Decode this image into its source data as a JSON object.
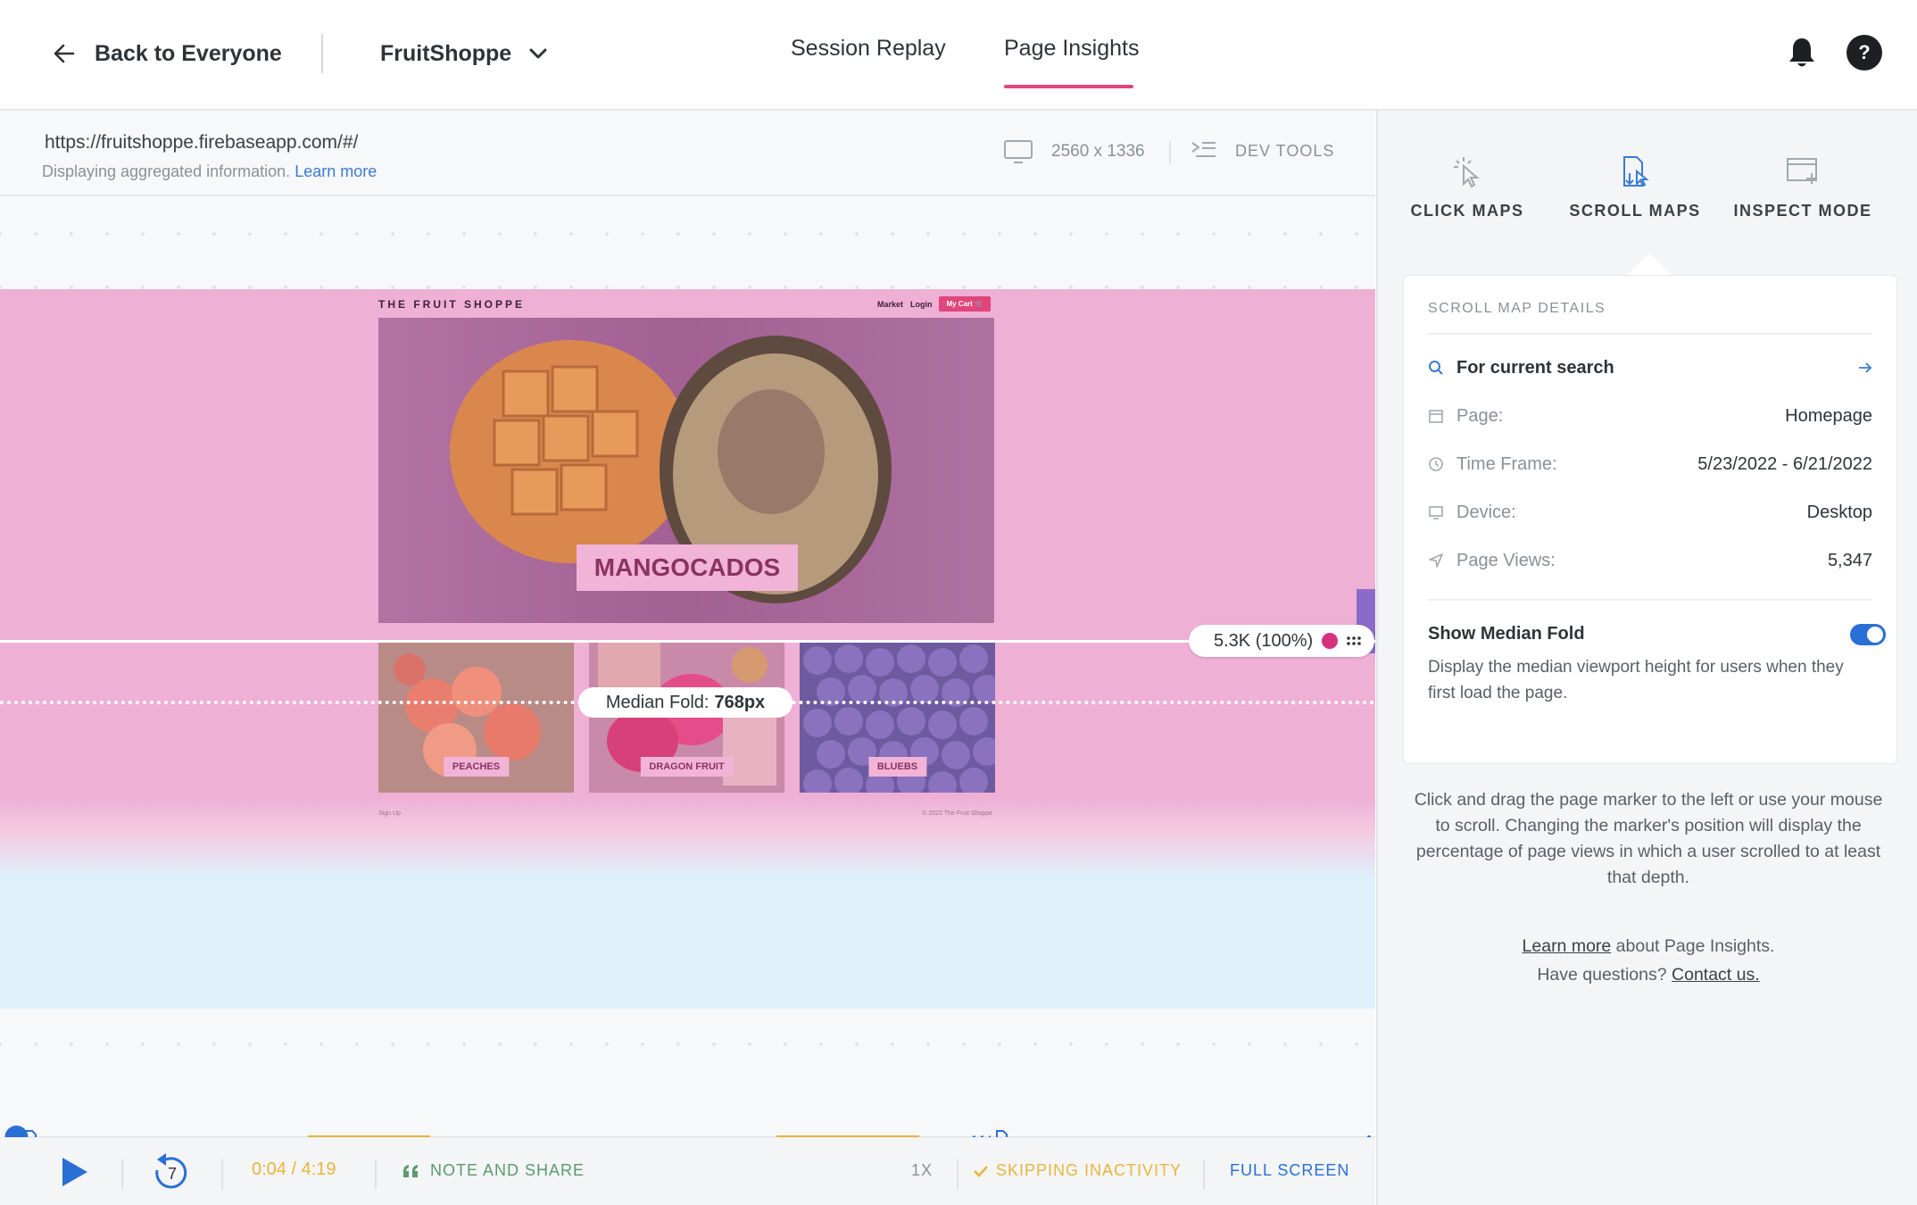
{
  "header": {
    "back_label": "Back to Everyone",
    "app_name": "FruitShoppe",
    "tabs": [
      {
        "label": "Session Replay",
        "active": false
      },
      {
        "label": "Page Insights",
        "active": true
      }
    ],
    "help_label": "?"
  },
  "page": {
    "url": "https://fruitshoppe.firebaseapp.com/#/",
    "subtitle": "Displaying aggregated information.",
    "subtitle_link": "Learn more",
    "resolution": "2560 x 1336",
    "dev_tools_label": "DEV TOOLS"
  },
  "site_preview": {
    "logo": "THE FRUIT SHOPPE",
    "nav": [
      "Market",
      "Login"
    ],
    "cart": "My Cart",
    "hero_title": "MANGOCADOS",
    "products": [
      "PEACHES",
      "DRAGON FRUIT",
      "BLUEBS"
    ],
    "footer_left": "Sign Up",
    "footer_right": "© 2022 The Fruit Shoppe"
  },
  "scroll_overlay": {
    "marker_label": "5.3K (100%)",
    "median_fold_label": "Median Fold:",
    "median_fold_value": "768px"
  },
  "player": {
    "time": "0:04 / 4:19",
    "rewind_seconds": "7",
    "note_share_label": "NOTE AND SHARE",
    "speed": "1X",
    "skip_label": "SKIPPING INACTIVITY",
    "fullscreen_label": "FULL SCREEN",
    "progress": 0.016
  },
  "panel": {
    "modes": [
      {
        "label": "CLICK MAPS",
        "icon": "click-cursor-icon",
        "active": false
      },
      {
        "label": "SCROLL MAPS",
        "icon": "scroll-page-icon",
        "active": true
      },
      {
        "label": "INSPECT MODE",
        "icon": "inspect-window-icon",
        "active": false
      }
    ],
    "details_title": "SCROLL MAP DETAILS",
    "search_label": "For current search",
    "rows": [
      {
        "label": "Page:",
        "value": "Homepage",
        "icon": "page-icon"
      },
      {
        "label": "Time Frame:",
        "value": "5/23/2022 - 6/21/2022",
        "icon": "clock-icon"
      },
      {
        "label": "Device:",
        "value": "Desktop",
        "icon": "monitor-icon"
      },
      {
        "label": "Page Views:",
        "value": "5,347",
        "icon": "location-arrow-icon"
      }
    ],
    "median_fold_title": "Show Median Fold",
    "median_fold_enabled": true,
    "median_fold_desc": "Display the median viewport height for users when they first load the page.",
    "help_text": "Click and drag the page marker to the left or use your mouse to scroll. Changing the marker's position will display the percentage of page views in which a user scrolled to at least that depth.",
    "learn_more": "Learn more",
    "learn_more_rest": " about Page Insights.",
    "questions": "Have questions? ",
    "contact": "Contact us."
  },
  "colors": {
    "accent_pink": "#e0457b",
    "heat_pink": "#efb0d6",
    "heat_blue": "#def1fb",
    "link_blue": "#3a7bd5",
    "player_yellow": "#e8b53c",
    "note_green": "#5a9a6e"
  }
}
